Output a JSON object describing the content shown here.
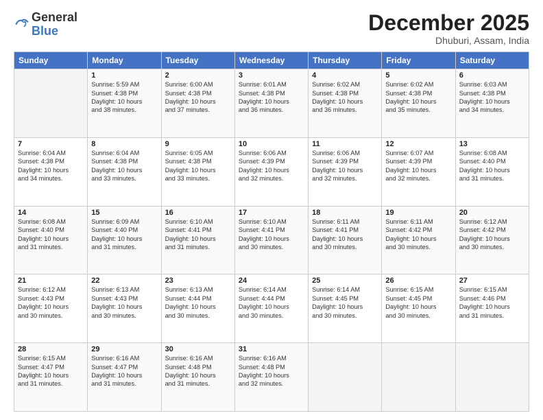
{
  "logo": {
    "general": "General",
    "blue": "Blue"
  },
  "header": {
    "month": "December 2025",
    "location": "Dhuburi, Assam, India"
  },
  "weekdays": [
    "Sunday",
    "Monday",
    "Tuesday",
    "Wednesday",
    "Thursday",
    "Friday",
    "Saturday"
  ],
  "weeks": [
    [
      {
        "day": "",
        "info": ""
      },
      {
        "day": "1",
        "info": "Sunrise: 5:59 AM\nSunset: 4:38 PM\nDaylight: 10 hours\nand 38 minutes."
      },
      {
        "day": "2",
        "info": "Sunrise: 6:00 AM\nSunset: 4:38 PM\nDaylight: 10 hours\nand 37 minutes."
      },
      {
        "day": "3",
        "info": "Sunrise: 6:01 AM\nSunset: 4:38 PM\nDaylight: 10 hours\nand 36 minutes."
      },
      {
        "day": "4",
        "info": "Sunrise: 6:02 AM\nSunset: 4:38 PM\nDaylight: 10 hours\nand 36 minutes."
      },
      {
        "day": "5",
        "info": "Sunrise: 6:02 AM\nSunset: 4:38 PM\nDaylight: 10 hours\nand 35 minutes."
      },
      {
        "day": "6",
        "info": "Sunrise: 6:03 AM\nSunset: 4:38 PM\nDaylight: 10 hours\nand 34 minutes."
      }
    ],
    [
      {
        "day": "7",
        "info": "Sunrise: 6:04 AM\nSunset: 4:38 PM\nDaylight: 10 hours\nand 34 minutes."
      },
      {
        "day": "8",
        "info": "Sunrise: 6:04 AM\nSunset: 4:38 PM\nDaylight: 10 hours\nand 33 minutes."
      },
      {
        "day": "9",
        "info": "Sunrise: 6:05 AM\nSunset: 4:38 PM\nDaylight: 10 hours\nand 33 minutes."
      },
      {
        "day": "10",
        "info": "Sunrise: 6:06 AM\nSunset: 4:39 PM\nDaylight: 10 hours\nand 32 minutes."
      },
      {
        "day": "11",
        "info": "Sunrise: 6:06 AM\nSunset: 4:39 PM\nDaylight: 10 hours\nand 32 minutes."
      },
      {
        "day": "12",
        "info": "Sunrise: 6:07 AM\nSunset: 4:39 PM\nDaylight: 10 hours\nand 32 minutes."
      },
      {
        "day": "13",
        "info": "Sunrise: 6:08 AM\nSunset: 4:40 PM\nDaylight: 10 hours\nand 31 minutes."
      }
    ],
    [
      {
        "day": "14",
        "info": "Sunrise: 6:08 AM\nSunset: 4:40 PM\nDaylight: 10 hours\nand 31 minutes."
      },
      {
        "day": "15",
        "info": "Sunrise: 6:09 AM\nSunset: 4:40 PM\nDaylight: 10 hours\nand 31 minutes."
      },
      {
        "day": "16",
        "info": "Sunrise: 6:10 AM\nSunset: 4:41 PM\nDaylight: 10 hours\nand 31 minutes."
      },
      {
        "day": "17",
        "info": "Sunrise: 6:10 AM\nSunset: 4:41 PM\nDaylight: 10 hours\nand 30 minutes."
      },
      {
        "day": "18",
        "info": "Sunrise: 6:11 AM\nSunset: 4:41 PM\nDaylight: 10 hours\nand 30 minutes."
      },
      {
        "day": "19",
        "info": "Sunrise: 6:11 AM\nSunset: 4:42 PM\nDaylight: 10 hours\nand 30 minutes."
      },
      {
        "day": "20",
        "info": "Sunrise: 6:12 AM\nSunset: 4:42 PM\nDaylight: 10 hours\nand 30 minutes."
      }
    ],
    [
      {
        "day": "21",
        "info": "Sunrise: 6:12 AM\nSunset: 4:43 PM\nDaylight: 10 hours\nand 30 minutes."
      },
      {
        "day": "22",
        "info": "Sunrise: 6:13 AM\nSunset: 4:43 PM\nDaylight: 10 hours\nand 30 minutes."
      },
      {
        "day": "23",
        "info": "Sunrise: 6:13 AM\nSunset: 4:44 PM\nDaylight: 10 hours\nand 30 minutes."
      },
      {
        "day": "24",
        "info": "Sunrise: 6:14 AM\nSunset: 4:44 PM\nDaylight: 10 hours\nand 30 minutes."
      },
      {
        "day": "25",
        "info": "Sunrise: 6:14 AM\nSunset: 4:45 PM\nDaylight: 10 hours\nand 30 minutes."
      },
      {
        "day": "26",
        "info": "Sunrise: 6:15 AM\nSunset: 4:45 PM\nDaylight: 10 hours\nand 30 minutes."
      },
      {
        "day": "27",
        "info": "Sunrise: 6:15 AM\nSunset: 4:46 PM\nDaylight: 10 hours\nand 31 minutes."
      }
    ],
    [
      {
        "day": "28",
        "info": "Sunrise: 6:15 AM\nSunset: 4:47 PM\nDaylight: 10 hours\nand 31 minutes."
      },
      {
        "day": "29",
        "info": "Sunrise: 6:16 AM\nSunset: 4:47 PM\nDaylight: 10 hours\nand 31 minutes."
      },
      {
        "day": "30",
        "info": "Sunrise: 6:16 AM\nSunset: 4:48 PM\nDaylight: 10 hours\nand 31 minutes."
      },
      {
        "day": "31",
        "info": "Sunrise: 6:16 AM\nSunset: 4:48 PM\nDaylight: 10 hours\nand 32 minutes."
      },
      {
        "day": "",
        "info": ""
      },
      {
        "day": "",
        "info": ""
      },
      {
        "day": "",
        "info": ""
      }
    ]
  ]
}
